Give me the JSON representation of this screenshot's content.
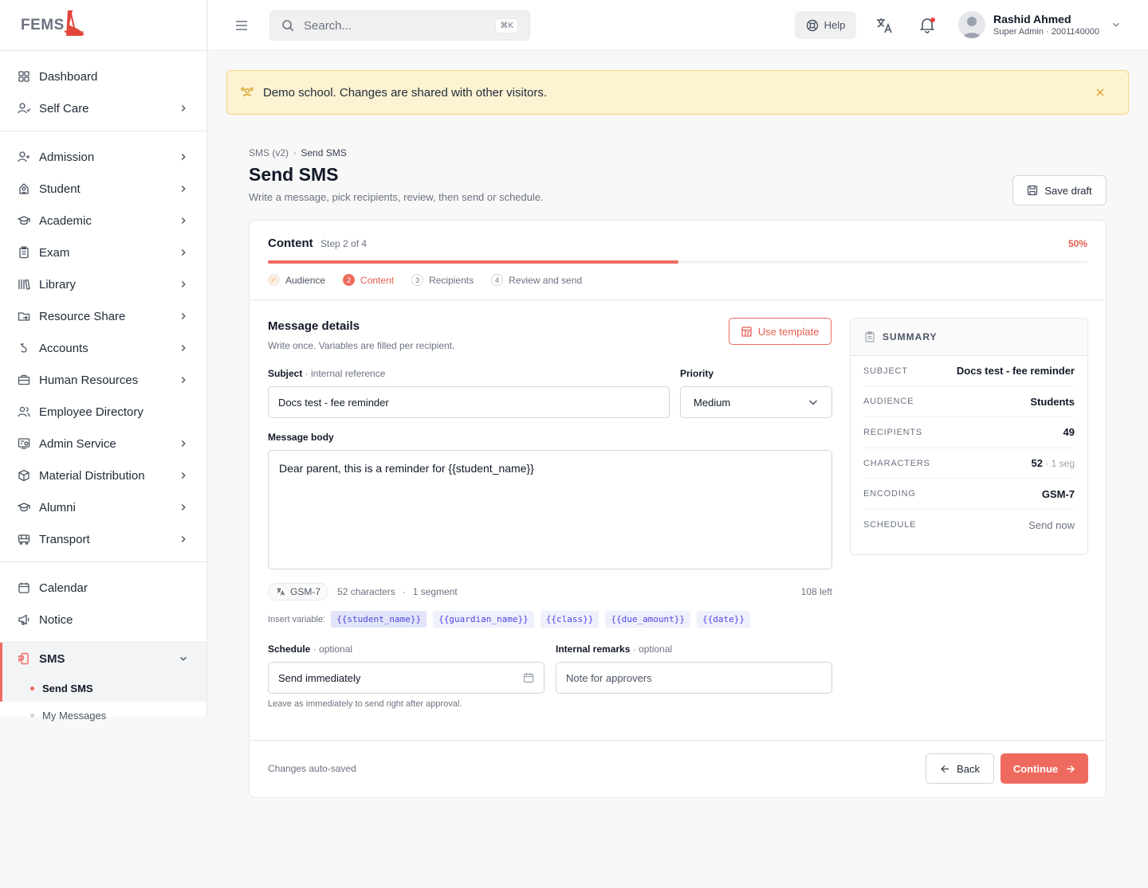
{
  "brand": {
    "logo_text": "FEMS",
    "accent": "#ef6a5e"
  },
  "sidebar": {
    "groups": [
      [
        {
          "label": "Dashboard",
          "icon": "grid-icon",
          "chevron": false
        },
        {
          "label": "Self Care",
          "icon": "user-heart-icon",
          "chevron": true
        }
      ],
      [
        {
          "label": "Admission",
          "icon": "user-plus-icon",
          "chevron": true
        },
        {
          "label": "Student",
          "icon": "student-icon",
          "chevron": true
        },
        {
          "label": "Academic",
          "icon": "graduation-cap-icon",
          "chevron": true
        },
        {
          "label": "Exam",
          "icon": "clipboard-icon",
          "chevron": true
        },
        {
          "label": "Library",
          "icon": "library-icon",
          "chevron": true
        },
        {
          "label": "Resource Share",
          "icon": "folder-share-icon",
          "chevron": true
        },
        {
          "label": "Accounts",
          "icon": "accounts-icon",
          "chevron": true
        },
        {
          "label": "Human Resources",
          "icon": "briefcase-icon",
          "chevron": true
        },
        {
          "label": "Employee Directory",
          "icon": "users-icon",
          "chevron": false
        },
        {
          "label": "Admin Service",
          "icon": "admin-service-icon",
          "chevron": true
        },
        {
          "label": "Material Distribution",
          "icon": "package-icon",
          "chevron": true
        },
        {
          "label": "Alumni",
          "icon": "graduation-cap-icon",
          "chevron": true
        },
        {
          "label": "Transport",
          "icon": "bus-icon",
          "chevron": true
        }
      ],
      [
        {
          "label": "Calendar",
          "icon": "calendar-icon",
          "chevron": false
        },
        {
          "label": "Notice",
          "icon": "megaphone-icon",
          "chevron": false
        }
      ]
    ],
    "sms": {
      "label": "SMS",
      "icon": "sms-icon",
      "sub_items": [
        {
          "label": "Send SMS",
          "active": true
        },
        {
          "label": "My Messages",
          "active": false
        }
      ]
    }
  },
  "topbar": {
    "search_placeholder": "Search...",
    "search_shortcut": "⌘K",
    "help_label": "Help",
    "user": {
      "name": "Rashid Ahmed",
      "role": "Super Admin · 2001140000"
    }
  },
  "alert": {
    "text": "Demo school. Changes are shared with other visitors."
  },
  "page": {
    "breadcrumb": [
      "SMS (v2)",
      "Send SMS"
    ],
    "title": "Send SMS",
    "subtitle": "Write a message, pick recipients, review, then send or schedule.",
    "save_draft_label": "Save draft"
  },
  "wizard": {
    "step_title": "Content",
    "step_count": "Step 2 of 4",
    "percent_label": "50%",
    "progress_fraction": 0.5,
    "steps": [
      {
        "num": "✓",
        "label": "Audience",
        "state": "done"
      },
      {
        "num": "2",
        "label": "Content",
        "state": "current"
      },
      {
        "num": "3",
        "label": "Recipients",
        "state": "pending"
      },
      {
        "num": "4",
        "label": "Review and send",
        "state": "pending"
      }
    ]
  },
  "form": {
    "section_title": "Message details",
    "section_subtitle": "Write once. Variables are filled per recipient.",
    "use_template_label": "Use template",
    "subject_label": "Subject",
    "subject_hint": " · internal reference",
    "subject_value": "Docs test - fee reminder",
    "priority_label": "Priority",
    "priority_value": "Medium",
    "body_label": "Message body",
    "body_value": "Dear parent, this is a reminder for {{student_name}}",
    "encoding": "GSM-7",
    "characters": "52 characters",
    "segments": "1 segment",
    "remaining": "108 left",
    "insert_variable_label": "Insert variable:",
    "variables": [
      "{{student_name}}",
      "{{guardian_name}}",
      "{{class}}",
      "{{due_amount}}",
      "{{date}}"
    ],
    "schedule_label": "Schedule",
    "schedule_hint": " · optional",
    "schedule_value": "Send immediately",
    "schedule_help": "Leave as immediately to send right after approval.",
    "remarks_label": "Internal remarks",
    "remarks_hint": " · optional",
    "remarks_placeholder": "Note for approvers"
  },
  "summary": {
    "title": "SUMMARY",
    "rows": [
      {
        "key": "Subject",
        "value": "Docs test - fee reminder",
        "extra": "",
        "muted": false
      },
      {
        "key": "Audience",
        "value": "Students",
        "extra": "",
        "muted": false
      },
      {
        "key": "Recipients",
        "value": "49",
        "extra": "",
        "muted": false
      },
      {
        "key": "Characters",
        "value": "52",
        "extra": " · 1 seg",
        "muted": false
      },
      {
        "key": "Encoding",
        "value": "GSM-7",
        "extra": "",
        "muted": false
      },
      {
        "key": "Schedule",
        "value": "Send now",
        "extra": "",
        "muted": true
      }
    ]
  },
  "footer": {
    "autosave_text": "Changes auto-saved",
    "back_label": "Back",
    "continue_label": "Continue"
  }
}
